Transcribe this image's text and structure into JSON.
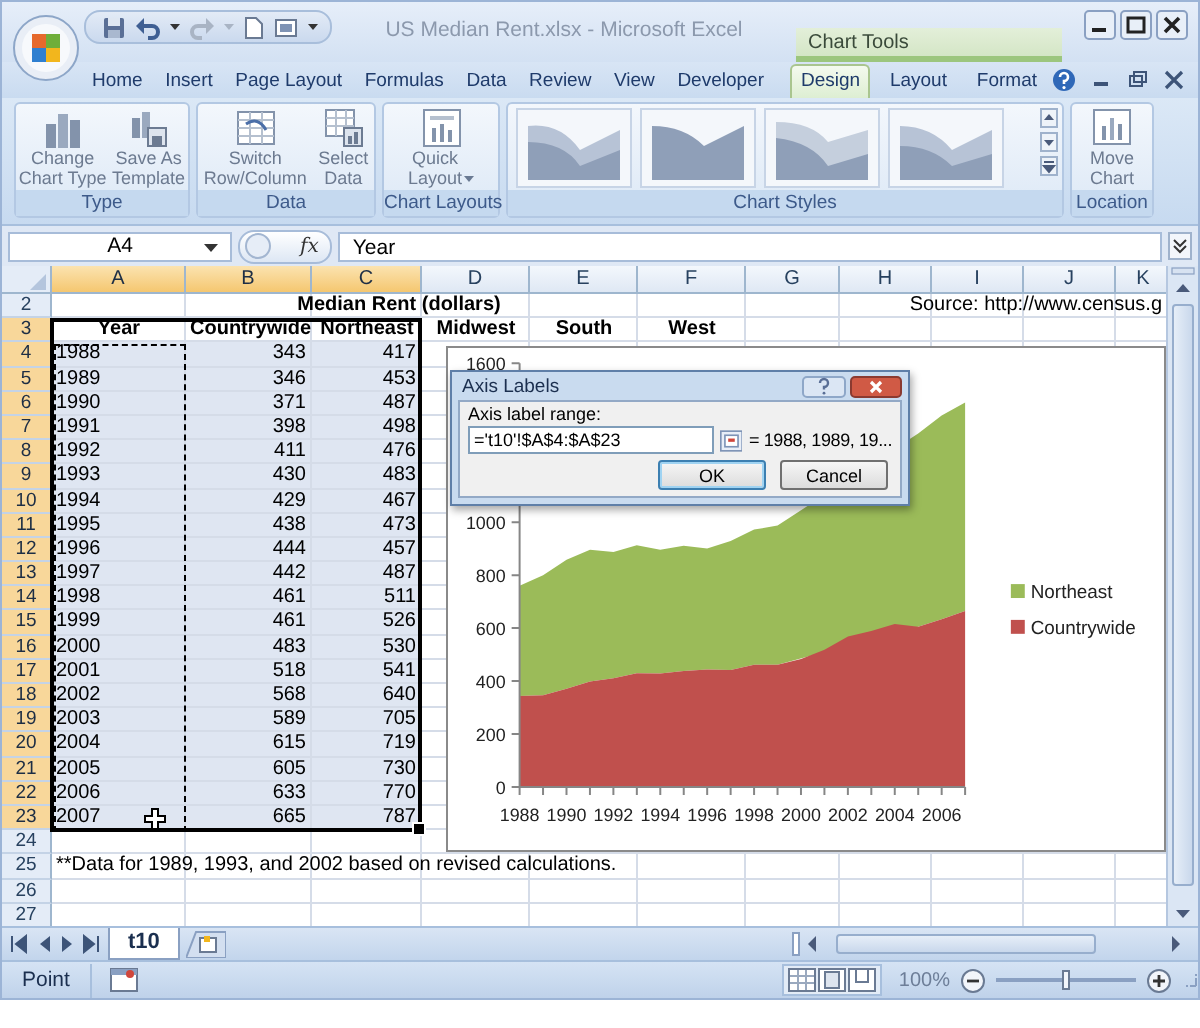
{
  "window": {
    "title": "US Median Rent.xlsx - Microsoft Excel"
  },
  "ribbon_tabs": [
    {
      "label": "Home",
      "selected": false
    },
    {
      "label": "Insert",
      "selected": false
    },
    {
      "label": "Page Layout",
      "selected": false
    },
    {
      "label": "Formulas",
      "selected": false
    },
    {
      "label": "Data",
      "selected": false
    },
    {
      "label": "Review",
      "selected": false
    },
    {
      "label": "View",
      "selected": false
    },
    {
      "label": "Developer",
      "selected": false
    }
  ],
  "contextual_tabs": {
    "label": "Chart Tools",
    "tabs": [
      {
        "label": "Design",
        "selected": true
      },
      {
        "label": "Layout",
        "selected": false
      },
      {
        "label": "Format",
        "selected": false
      }
    ]
  },
  "ribbon_groups": [
    {
      "kind": "buttons",
      "label": "Type",
      "buttons": [
        {
          "label": "Change\nChart Type",
          "dropdown": false
        },
        {
          "label": "Save As\nTemplate",
          "dropdown": false
        }
      ]
    },
    {
      "kind": "buttons",
      "label": "Data",
      "buttons": [
        {
          "label": "Switch\nRow/Column",
          "dropdown": false
        },
        {
          "label": "Select\nData",
          "dropdown": false
        }
      ]
    },
    {
      "kind": "buttons",
      "label": "Chart Layouts",
      "buttons": [
        {
          "label": "Quick\nLayout",
          "dropdown": true
        }
      ]
    },
    {
      "kind": "gallery",
      "label": "Chart Styles"
    },
    {
      "kind": "buttons",
      "label": "Location",
      "buttons": [
        {
          "label": "Move\nChart",
          "dropdown": false
        }
      ]
    }
  ],
  "formula_bar": {
    "name_box": "A4",
    "function_label": "fx",
    "formula": "Year"
  },
  "sheet": {
    "selection_outline": true,
    "copy_marquee": true,
    "columns": [
      {
        "label": "A",
        "selected": true
      },
      {
        "label": "B",
        "selected": true
      },
      {
        "label": "C",
        "selected": true
      },
      {
        "label": "D",
        "selected": false
      },
      {
        "label": "E",
        "selected": false
      },
      {
        "label": "F",
        "selected": false
      },
      {
        "label": "G",
        "selected": false
      },
      {
        "label": "H",
        "selected": false
      },
      {
        "label": "I",
        "selected": false
      },
      {
        "label": "J",
        "selected": false
      },
      {
        "label": "K",
        "selected": false
      }
    ],
    "rows": [
      {
        "kind": "title",
        "number": "2",
        "selected": false,
        "title": "Median Rent (dollars)",
        "note": "Source: http://www.census.g"
      },
      {
        "kind": "header",
        "number": "3",
        "selected": true,
        "cells": [
          "Year",
          "Countrywide",
          "Northeast",
          "Midwest",
          "South",
          "West"
        ]
      },
      {
        "kind": "data",
        "number": "4",
        "selected": true,
        "cells": [
          "1988",
          "343",
          "417"
        ]
      },
      {
        "kind": "data",
        "number": "5",
        "selected": true,
        "cells": [
          "1989",
          "346",
          "453"
        ]
      },
      {
        "kind": "data",
        "number": "6",
        "selected": true,
        "cells": [
          "1990",
          "371",
          "487"
        ]
      },
      {
        "kind": "data",
        "number": "7",
        "selected": true,
        "cells": [
          "1991",
          "398",
          "498"
        ]
      },
      {
        "kind": "data",
        "number": "8",
        "selected": true,
        "cells": [
          "1992",
          "411",
          "476"
        ]
      },
      {
        "kind": "data",
        "number": "9",
        "selected": true,
        "cells": [
          "1993",
          "430",
          "483"
        ]
      },
      {
        "kind": "data",
        "number": "10",
        "selected": true,
        "cells": [
          "1994",
          "429",
          "467"
        ]
      },
      {
        "kind": "data",
        "number": "11",
        "selected": true,
        "cells": [
          "1995",
          "438",
          "473"
        ]
      },
      {
        "kind": "data",
        "number": "12",
        "selected": true,
        "cells": [
          "1996",
          "444",
          "457"
        ]
      },
      {
        "kind": "data",
        "number": "13",
        "selected": true,
        "cells": [
          "1997",
          "442",
          "487"
        ]
      },
      {
        "kind": "data",
        "number": "14",
        "selected": true,
        "cells": [
          "1998",
          "461",
          "511"
        ]
      },
      {
        "kind": "data",
        "number": "15",
        "selected": true,
        "cells": [
          "1999",
          "461",
          "526"
        ]
      },
      {
        "kind": "data",
        "number": "16",
        "selected": true,
        "cells": [
          "2000",
          "483",
          "530"
        ]
      },
      {
        "kind": "data",
        "number": "17",
        "selected": true,
        "cells": [
          "2001",
          "518",
          "541"
        ]
      },
      {
        "kind": "data",
        "number": "18",
        "selected": true,
        "cells": [
          "2002",
          "568",
          "640"
        ]
      },
      {
        "kind": "data",
        "number": "19",
        "selected": true,
        "cells": [
          "2003",
          "589",
          "705"
        ]
      },
      {
        "kind": "data",
        "number": "20",
        "selected": true,
        "cells": [
          "2004",
          "615",
          "719"
        ]
      },
      {
        "kind": "data",
        "number": "21",
        "selected": true,
        "cells": [
          "2005",
          "605",
          "730"
        ]
      },
      {
        "kind": "data",
        "number": "22",
        "selected": true,
        "cells": [
          "2006",
          "633",
          "770"
        ]
      },
      {
        "kind": "data",
        "number": "23",
        "selected": true,
        "cells": [
          "2007",
          "665",
          "787"
        ]
      },
      {
        "kind": "blank",
        "number": "24",
        "selected": false
      },
      {
        "kind": "note",
        "number": "25",
        "selected": false,
        "text": "**Data for 1989, 1993, and 2002 based on revised calculations."
      },
      {
        "kind": "blank",
        "number": "26",
        "selected": false
      },
      {
        "kind": "blank",
        "number": "27",
        "selected": false
      }
    ]
  },
  "chart": {
    "chart_data": {
      "type": "area",
      "stacked": true,
      "x": [
        1988,
        1989,
        1990,
        1991,
        1992,
        1993,
        1994,
        1995,
        1996,
        1997,
        1998,
        1999,
        2000,
        2001,
        2002,
        2003,
        2004,
        2005,
        2006,
        2007
      ],
      "series": [
        {
          "name": "Countrywide",
          "color": "#c0504d",
          "values": [
            343,
            346,
            371,
            398,
            411,
            430,
            429,
            438,
            444,
            442,
            461,
            461,
            483,
            518,
            568,
            589,
            615,
            605,
            633,
            665
          ]
        },
        {
          "name": "Northeast",
          "color": "#9bbb59",
          "values": [
            417,
            453,
            487,
            498,
            476,
            483,
            467,
            473,
            457,
            487,
            511,
            526,
            null,
            null,
            null,
            null,
            null,
            730,
            770,
            787
          ]
        }
      ],
      "xlim": [
        1988,
        2007
      ],
      "ylim": [
        0,
        1600
      ],
      "yticks": [
        0,
        200,
        400,
        600,
        800,
        1000,
        1600
      ],
      "xticks": [
        {
          "value": 1988,
          "label": "1988"
        },
        {
          "value": 1990,
          "label": "1990"
        },
        {
          "value": 1992,
          "label": "1992"
        },
        {
          "value": 1994,
          "label": "1994"
        },
        {
          "value": 1996,
          "label": "1996"
        },
        {
          "value": 1998,
          "label": "1998"
        },
        {
          "value": 2000,
          "label": "2000"
        },
        {
          "value": 2002,
          "label": "2002"
        },
        {
          "value": 2004,
          "label": "2004"
        },
        {
          "value": 2006,
          "label": "2006"
        }
      ],
      "legend": "right"
    }
  },
  "dialog": {
    "title": "Axis Labels",
    "field_label": "Axis label range:",
    "field_value": "='t10'!$A$4:$A$23",
    "preview": "= 1988, 1989, 19...",
    "buttons": [
      {
        "label": "OK",
        "default": true
      },
      {
        "label": "Cancel",
        "default": false
      }
    ]
  },
  "sheet_tabs": [
    {
      "label": "t10",
      "selected": true
    }
  ],
  "status_bar": {
    "mode": "Point",
    "zoom": {
      "label": "100%",
      "level": 0.5
    }
  }
}
